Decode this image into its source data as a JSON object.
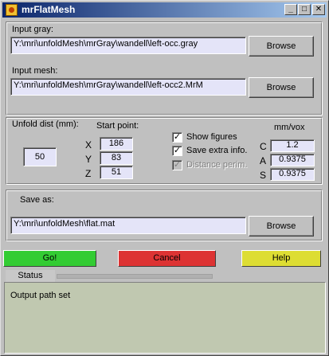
{
  "window": {
    "title": "mrFlatMesh",
    "minimize": "_",
    "maximize": "□",
    "close": "✕"
  },
  "input": {
    "gray_label": "Input gray:",
    "gray_value": "Y:\\mri\\unfoldMesh\\mrGray\\wandell\\left-occ.gray",
    "gray_browse": "Browse",
    "mesh_label": "Input mesh:",
    "mesh_value": "Y:\\mri\\unfoldMesh\\mrGray\\wandell\\left-occ2.MrM",
    "mesh_browse": "Browse"
  },
  "params": {
    "unfold_label": "Unfold dist (mm):",
    "unfold_value": "50",
    "start_label": "Start point:",
    "x_label": "X",
    "x_value": "186",
    "y_label": "Y",
    "y_value": "83",
    "z_label": "Z",
    "z_value": "51",
    "show_figures": "Show figures",
    "save_extra": "Save extra info.",
    "distance_perim": "Distance perim.",
    "check_mark": "✓",
    "mmvox_label": "mm/vox",
    "c_label": "C",
    "c_value": "1.2",
    "a_label": "A",
    "a_value": "0.9375",
    "s_label": "S",
    "s_value": "0.9375"
  },
  "save": {
    "label": "Save as:",
    "value": "Y:\\mri\\unfoldMesh\\flat.mat",
    "browse": "Browse"
  },
  "actions": {
    "go": "Go!",
    "cancel": "Cancel",
    "help": "Help"
  },
  "status": {
    "tab": "Status",
    "message": "Output path set"
  },
  "colors": {
    "go": "#33cc33",
    "cancel": "#dd3333",
    "help": "#dddd33",
    "status_bg": "#c0c8b0",
    "edit_bg": "#e4e4f8"
  }
}
